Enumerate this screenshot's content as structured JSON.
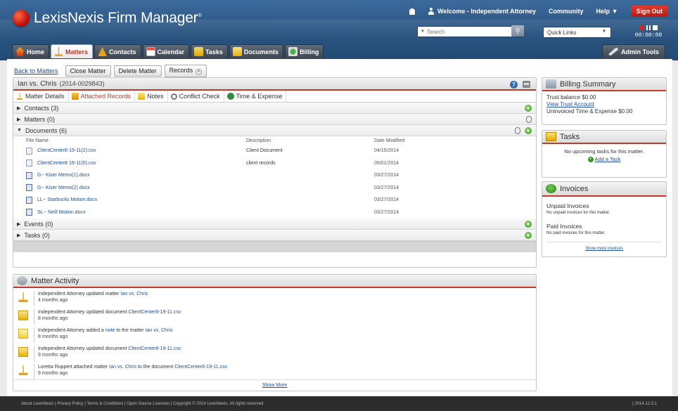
{
  "app": {
    "brand": "LexisNexis Firm Manager",
    "brand_mark": "®"
  },
  "topnav": {
    "welcome": "Welcome - Independent Attorney",
    "community": "Community",
    "help": "Help",
    "signout": "Sign Out"
  },
  "search": {
    "placeholder": "Search"
  },
  "quick_links": "Quick Links",
  "timer": "00:00:00",
  "tabs": [
    "Home",
    "Matters",
    "Contacts",
    "Calendar",
    "Tasks",
    "Documents",
    "Billing"
  ],
  "admin_tools": "Admin Tools",
  "actions": {
    "back": "Back to Matters",
    "close": "Close Matter",
    "delete": "Delete Matter",
    "records": "Records"
  },
  "matter": {
    "title": "Ian vs. Chris",
    "number": "(2014-0029843)",
    "subtabs": [
      "Matter Details",
      "Attached Records",
      "Notes",
      "Conflict Check",
      "Time & Expense"
    ],
    "sections": {
      "contacts": "Contacts (3)",
      "matters": "Matters (0)",
      "documents": "Documents (6)",
      "events": "Events (0)",
      "tasks": "Tasks (0)"
    },
    "doc_columns": [
      "File Name",
      "Description",
      "Date Modified"
    ],
    "documents": [
      {
        "name": "ClientCenter8-19-11(2).csv",
        "desc": "Client Document",
        "date": "04/15/2014"
      },
      {
        "name": "ClientCenter8-19-11(5).csv",
        "desc": "client records",
        "date": "05/01/2014"
      },
      {
        "name": "G-- Kiser Memo(1).docx",
        "desc": "",
        "date": "03/27/2014"
      },
      {
        "name": "G-- Kiser Memo(2).docx",
        "desc": "",
        "date": "03/27/2014"
      },
      {
        "name": "LL-- Starbucks Motion.docx",
        "desc": "",
        "date": "03/27/2014"
      },
      {
        "name": "SL-- Neill Motion.docx",
        "desc": "",
        "date": "03/27/2014"
      }
    ]
  },
  "activity": {
    "title": "Matter Activity",
    "items": [
      {
        "pre": "Independent Attorney updated matter ",
        "link": "Ian vs. Chris",
        "mid": "",
        "link2": "",
        "post": "",
        "time": "4 months ago"
      },
      {
        "pre": "Independent Attorney updated document ",
        "link": "ClientCenter8-19-11.csv",
        "mid": "",
        "link2": "",
        "post": "",
        "time": "8 months ago"
      },
      {
        "pre": "Independent Attorney added a ",
        "link": "note",
        "mid": " to the matter ",
        "link2": "Ian vs. Chris",
        "post": "",
        "time": "8 months ago"
      },
      {
        "pre": "Independent Attorney updated document ",
        "link": "ClientCenter8-19-11.csv",
        "mid": "",
        "link2": "",
        "post": "",
        "time": "9 months ago"
      },
      {
        "pre": "Loretta Ruppert attached matter ",
        "link": "Ian vs. Chris",
        "mid": " to the document ",
        "link2": "ClientCenter8-19-11.csv",
        "post": "",
        "time": "9 months ago"
      }
    ],
    "show_more": "Show More"
  },
  "billing": {
    "title": "Billing Summary",
    "trust": "Trust balance $0.00",
    "view_trust": "View Trust Account",
    "uninvoiced": "Uninvoiced Time & Expense $0.00"
  },
  "tasks_panel": {
    "title": "Tasks",
    "empty": "No upcoming tasks for this matter.",
    "add": "Add a Task"
  },
  "invoices": {
    "title": "Invoices",
    "unpaid": "Unpaid Invoices",
    "unpaid_empty": "No unpaid invoices for this matter.",
    "paid": "Paid Invoices",
    "paid_empty": "No paid invoices for this matter.",
    "more": "Show more invoices"
  },
  "footer": {
    "links": "About LexisNexis  |  Privacy Policy  |  Terms & Conditions  |  Open Source Licenses  |  Copyright © 2014 LexisNexis. All rights reserved.",
    "version": "| 2014.12.3.1"
  }
}
